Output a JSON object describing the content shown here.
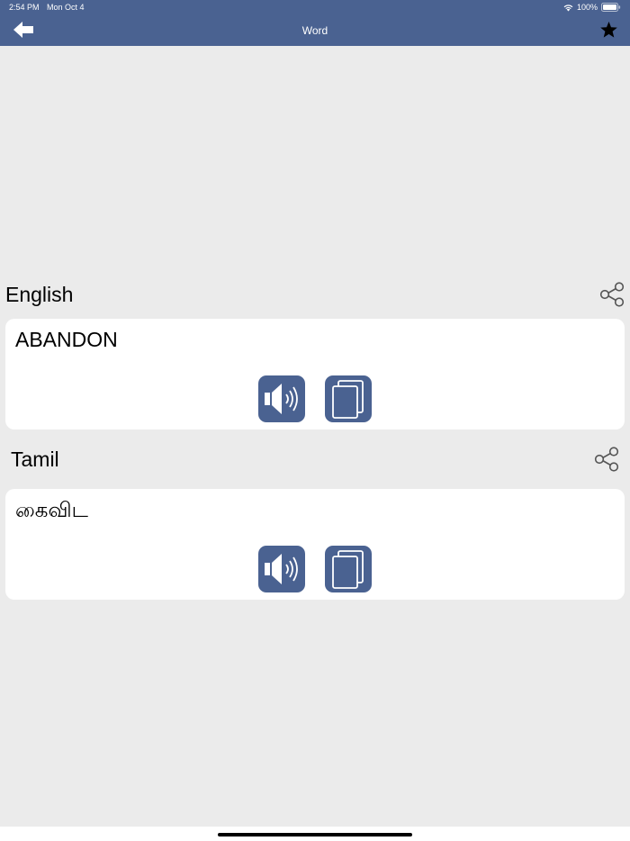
{
  "status_bar": {
    "time": "2:54 PM",
    "date": "Mon Oct 4",
    "battery": "100%"
  },
  "nav": {
    "title": "Word",
    "back_icon": "back-arrow-icon",
    "favorite_icon": "star-icon"
  },
  "sections": [
    {
      "label": "English",
      "text": "ABANDON",
      "share_icon": "share-icon",
      "speak_icon": "speaker-icon",
      "copy_icon": "copy-icon"
    },
    {
      "label": "Tamil",
      "text": "கைவிட",
      "share_icon": "share-icon",
      "speak_icon": "speaker-icon",
      "copy_icon": "copy-icon"
    }
  ],
  "colors": {
    "accent": "#4a6291",
    "background": "#ebebeb",
    "card": "#ffffff"
  }
}
